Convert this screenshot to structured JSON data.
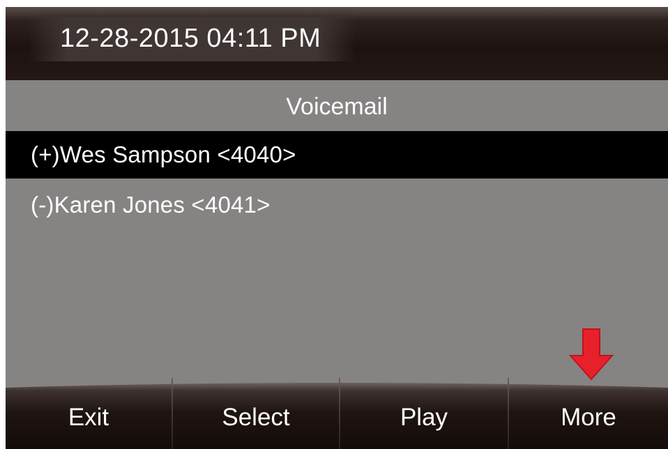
{
  "status_bar": {
    "datetime": "12-28-2015 04:11 PM"
  },
  "screen": {
    "title": "Voicemail"
  },
  "voicemail_list": [
    {
      "label": "(+)Wes Sampson <4040>",
      "selected": true
    },
    {
      "label": "(-)Karen Jones <4041>",
      "selected": false
    }
  ],
  "softkeys": [
    {
      "label": "Exit"
    },
    {
      "label": "Select"
    },
    {
      "label": "Play"
    },
    {
      "label": "More"
    }
  ],
  "indicator": {
    "icon": "down-arrow-icon",
    "color": "#e8202a"
  },
  "colors": {
    "background": "#868383",
    "topbar": "#1c1210",
    "selected_row": "#000000",
    "text": "#ffffff"
  }
}
